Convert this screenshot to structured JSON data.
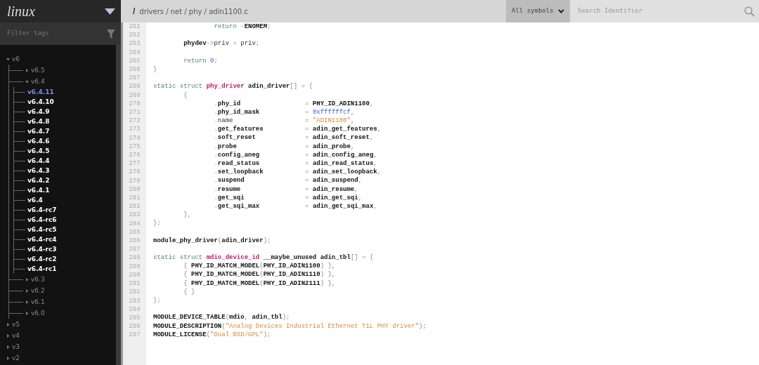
{
  "sidebar": {
    "project": "linux",
    "filter": {
      "placeholder": "Filter tags"
    },
    "tags": [
      {
        "label": "v6",
        "expanded": true,
        "selected": false,
        "children": [
          {
            "label": "v6.5",
            "expanded": false,
            "selected": false
          },
          {
            "label": "v6.4",
            "expanded": true,
            "selected": false,
            "children": [
              {
                "label": "v6.4.11",
                "selected": true
              },
              {
                "label": "v6.4.10",
                "selected": false
              },
              {
                "label": "v6.4.9",
                "selected": false
              },
              {
                "label": "v6.4.8",
                "selected": false
              },
              {
                "label": "v6.4.7",
                "selected": false
              },
              {
                "label": "v6.4.6",
                "selected": false
              },
              {
                "label": "v6.4.5",
                "selected": false
              },
              {
                "label": "v6.4.4",
                "selected": false
              },
              {
                "label": "v6.4.3",
                "selected": false
              },
              {
                "label": "v6.4.2",
                "selected": false
              },
              {
                "label": "v6.4.1",
                "selected": false
              },
              {
                "label": "v6.4",
                "selected": false
              },
              {
                "label": "v6.4-rc7",
                "selected": false
              },
              {
                "label": "v6.4-rc6",
                "selected": false
              },
              {
                "label": "v6.4-rc5",
                "selected": false
              },
              {
                "label": "v6.4-rc4",
                "selected": false
              },
              {
                "label": "v6.4-rc3",
                "selected": false
              },
              {
                "label": "v6.4-rc2",
                "selected": false
              },
              {
                "label": "v6.4-rc1",
                "selected": false
              }
            ]
          },
          {
            "label": "v6.3",
            "expanded": false,
            "selected": false
          },
          {
            "label": "v6.2",
            "expanded": false,
            "selected": false
          },
          {
            "label": "v6.1",
            "expanded": false,
            "selected": false
          },
          {
            "label": "v6.0",
            "expanded": false,
            "selected": false
          }
        ]
      },
      {
        "label": "v5",
        "expanded": false,
        "selected": false
      },
      {
        "label": "v4",
        "expanded": false,
        "selected": false
      },
      {
        "label": "v3",
        "expanded": false,
        "selected": false
      },
      {
        "label": "v2",
        "expanded": false,
        "selected": false
      }
    ]
  },
  "breadcrumb": {
    "root": "/",
    "path": "drivers / net / phy / adin1100.c"
  },
  "search": {
    "scope": "All symbols",
    "placeholder": "Search Identifier"
  },
  "code": [
    {
      "number": "261",
      "tokens": [
        {
          "kind": "kw",
          "text": "                return"
        },
        {
          "kind": "p",
          "text": " -"
        },
        {
          "kind": "id",
          "text": "ENOMEM"
        },
        {
          "kind": "p",
          "text": ";"
        }
      ]
    },
    {
      "number": "262"
    },
    {
      "number": "263",
      "tokens": [
        {
          "kind": "id",
          "text": "        phydev"
        },
        {
          "kind": "p",
          "text": "->"
        },
        {
          "kind": "t",
          "text": "priv"
        },
        {
          "kind": "p",
          "text": " = "
        },
        {
          "kind": "t",
          "text": "priv"
        },
        {
          "kind": "p",
          "text": ";"
        }
      ]
    },
    {
      "number": "264"
    },
    {
      "number": "265",
      "tokens": [
        {
          "kind": "kw",
          "text": "        return "
        },
        {
          "kind": "num",
          "text": "0"
        },
        {
          "kind": "p",
          "text": ";"
        }
      ]
    },
    {
      "number": "266",
      "tokens": [
        {
          "kind": "p",
          "text": "}"
        }
      ]
    },
    {
      "number": "267"
    },
    {
      "number": "268",
      "tokens": [
        {
          "kind": "kw",
          "text": "static struct "
        },
        {
          "kind": "type",
          "text": "phy_driver"
        },
        {
          "kind": "id",
          "text": " adin_driver"
        },
        {
          "kind": "p",
          "text": "[] = {"
        }
      ]
    },
    {
      "number": "269",
      "tokens": [
        {
          "kind": "p",
          "text": "        {"
        }
      ]
    },
    {
      "number": "270",
      "tokens": [
        {
          "kind": "p",
          "text": "                ."
        },
        {
          "kind": "id",
          "text": "phy_id"
        },
        {
          "kind": "p",
          "text": "                 = "
        },
        {
          "kind": "id",
          "text": "PHY_ID_ADIN1100"
        },
        {
          "kind": "p",
          "text": ","
        }
      ]
    },
    {
      "number": "271",
      "tokens": [
        {
          "kind": "p",
          "text": "                ."
        },
        {
          "kind": "id",
          "text": "phy_id_mask"
        },
        {
          "kind": "p",
          "text": "            = "
        },
        {
          "kind": "num",
          "text": "0xffffffcf"
        },
        {
          "kind": "p",
          "text": ","
        }
      ]
    },
    {
      "number": "272",
      "tokens": [
        {
          "kind": "p",
          "text": "                ."
        },
        {
          "kind": "t",
          "text": "name"
        },
        {
          "kind": "p",
          "text": "                   = "
        },
        {
          "kind": "str",
          "text": "\"ADIN1100\""
        },
        {
          "kind": "p",
          "text": ","
        }
      ]
    },
    {
      "number": "273",
      "tokens": [
        {
          "kind": "p",
          "text": "                ."
        },
        {
          "kind": "id",
          "text": "get_features"
        },
        {
          "kind": "p",
          "text": "           = "
        },
        {
          "kind": "id",
          "text": "adin_get_features"
        },
        {
          "kind": "p",
          "text": ","
        }
      ]
    },
    {
      "number": "274",
      "tokens": [
        {
          "kind": "p",
          "text": "                ."
        },
        {
          "kind": "id",
          "text": "soft_reset"
        },
        {
          "kind": "p",
          "text": "             = "
        },
        {
          "kind": "id",
          "text": "adin_soft_reset"
        },
        {
          "kind": "p",
          "text": ","
        }
      ]
    },
    {
      "number": "275",
      "tokens": [
        {
          "kind": "p",
          "text": "                ."
        },
        {
          "kind": "id",
          "text": "probe"
        },
        {
          "kind": "p",
          "text": "                  = "
        },
        {
          "kind": "id",
          "text": "adin_probe"
        },
        {
          "kind": "p",
          "text": ","
        }
      ]
    },
    {
      "number": "276",
      "tokens": [
        {
          "kind": "p",
          "text": "                ."
        },
        {
          "kind": "id",
          "text": "config_aneg"
        },
        {
          "kind": "p",
          "text": "            = "
        },
        {
          "kind": "id",
          "text": "adin_config_aneg"
        },
        {
          "kind": "p",
          "text": ","
        }
      ]
    },
    {
      "number": "277",
      "tokens": [
        {
          "kind": "p",
          "text": "                ."
        },
        {
          "kind": "id",
          "text": "read_status"
        },
        {
          "kind": "p",
          "text": "            = "
        },
        {
          "kind": "id",
          "text": "adin_read_status"
        },
        {
          "kind": "p",
          "text": ","
        }
      ]
    },
    {
      "number": "278",
      "tokens": [
        {
          "kind": "p",
          "text": "                ."
        },
        {
          "kind": "id",
          "text": "set_loopback"
        },
        {
          "kind": "p",
          "text": "           = "
        },
        {
          "kind": "id",
          "text": "adin_set_loopback"
        },
        {
          "kind": "p",
          "text": ","
        }
      ]
    },
    {
      "number": "279",
      "tokens": [
        {
          "kind": "p",
          "text": "                ."
        },
        {
          "kind": "id",
          "text": "suspend"
        },
        {
          "kind": "p",
          "text": "                = "
        },
        {
          "kind": "id",
          "text": "adin_suspend"
        },
        {
          "kind": "p",
          "text": ","
        }
      ]
    },
    {
      "number": "280",
      "tokens": [
        {
          "kind": "p",
          "text": "                ."
        },
        {
          "kind": "id",
          "text": "resume"
        },
        {
          "kind": "p",
          "text": "                 = "
        },
        {
          "kind": "id",
          "text": "adin_resume"
        },
        {
          "kind": "p",
          "text": ","
        }
      ]
    },
    {
      "number": "281",
      "tokens": [
        {
          "kind": "p",
          "text": "                ."
        },
        {
          "kind": "id",
          "text": "get_sqi"
        },
        {
          "kind": "p",
          "text": "                = "
        },
        {
          "kind": "id",
          "text": "adin_get_sqi"
        },
        {
          "kind": "p",
          "text": ","
        }
      ]
    },
    {
      "number": "282",
      "tokens": [
        {
          "kind": "p",
          "text": "                ."
        },
        {
          "kind": "id",
          "text": "get_sqi_max"
        },
        {
          "kind": "p",
          "text": "            = "
        },
        {
          "kind": "id",
          "text": "adin_get_sqi_max"
        },
        {
          "kind": "p",
          "text": ","
        }
      ]
    },
    {
      "number": "283",
      "tokens": [
        {
          "kind": "p",
          "text": "        },"
        }
      ]
    },
    {
      "number": "284",
      "tokens": [
        {
          "kind": "p",
          "text": "};"
        }
      ]
    },
    {
      "number": "285"
    },
    {
      "number": "286",
      "tokens": [
        {
          "kind": "id",
          "text": "module_phy_driver"
        },
        {
          "kind": "p",
          "text": "("
        },
        {
          "kind": "id",
          "text": "adin_driver"
        },
        {
          "kind": "p",
          "text": ");"
        }
      ]
    },
    {
      "number": "287"
    },
    {
      "number": "288",
      "tokens": [
        {
          "kind": "kw",
          "text": "static struct "
        },
        {
          "kind": "type",
          "text": "mdio_device_id"
        },
        {
          "kind": "id",
          "text": " __maybe_unused adin_tbl"
        },
        {
          "kind": "p",
          "text": "[] = {"
        }
      ]
    },
    {
      "number": "289",
      "tokens": [
        {
          "kind": "p",
          "text": "        { "
        },
        {
          "kind": "id",
          "text": "PHY_ID_MATCH_MODEL"
        },
        {
          "kind": "p",
          "text": "("
        },
        {
          "kind": "id",
          "text": "PHY_ID_ADIN1100"
        },
        {
          "kind": "p",
          "text": ") },"
        }
      ]
    },
    {
      "number": "290",
      "tokens": [
        {
          "kind": "p",
          "text": "        { "
        },
        {
          "kind": "id",
          "text": "PHY_ID_MATCH_MODEL"
        },
        {
          "kind": "p",
          "text": "("
        },
        {
          "kind": "id",
          "text": "PHY_ID_ADIN1110"
        },
        {
          "kind": "p",
          "text": ") },"
        }
      ]
    },
    {
      "number": "291",
      "tokens": [
        {
          "kind": "p",
          "text": "        { "
        },
        {
          "kind": "id",
          "text": "PHY_ID_MATCH_MODEL"
        },
        {
          "kind": "p",
          "text": "("
        },
        {
          "kind": "id",
          "text": "PHY_ID_ADIN2111"
        },
        {
          "kind": "p",
          "text": ") },"
        }
      ]
    },
    {
      "number": "292",
      "tokens": [
        {
          "kind": "p",
          "text": "        { }"
        }
      ]
    },
    {
      "number": "293",
      "tokens": [
        {
          "kind": "p",
          "text": "};"
        }
      ]
    },
    {
      "number": "294"
    },
    {
      "number": "295",
      "tokens": [
        {
          "kind": "id",
          "text": "MODULE_DEVICE_TABLE"
        },
        {
          "kind": "p",
          "text": "("
        },
        {
          "kind": "id",
          "text": "mdio"
        },
        {
          "kind": "p",
          "text": ", "
        },
        {
          "kind": "id",
          "text": "adin_tbl"
        },
        {
          "kind": "p",
          "text": ");"
        }
      ]
    },
    {
      "number": "296",
      "tokens": [
        {
          "kind": "id",
          "text": "MODULE_DESCRIPTION"
        },
        {
          "kind": "p",
          "text": "("
        },
        {
          "kind": "str",
          "text": "\"Analog Devices Industrial Ethernet T1L PHY driver\""
        },
        {
          "kind": "p",
          "text": ");"
        }
      ]
    },
    {
      "number": "297",
      "tokens": [
        {
          "kind": "id",
          "text": "MODULE_LICENSE"
        },
        {
          "kind": "p",
          "text": "("
        },
        {
          "kind": "str",
          "text": "\"Dual BSD/GPL\""
        },
        {
          "kind": "p",
          "text": ");"
        }
      ]
    }
  ]
}
